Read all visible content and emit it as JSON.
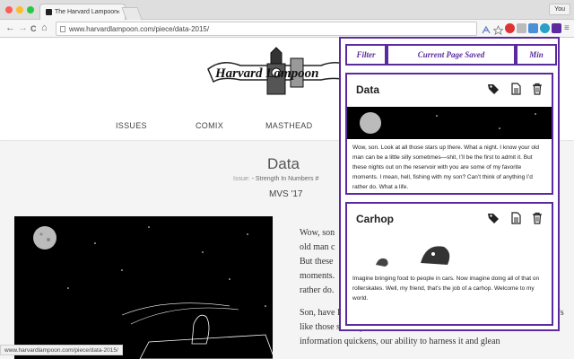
{
  "browser": {
    "tab_title": "The Harvard Lampoon",
    "tab_close": "×",
    "profile": "You",
    "url": "www.harvardlampoon.com/piece/data-2015/",
    "status_url": "www.harvardlampoon.com/piece/data-2015/",
    "nav": {
      "back": "←",
      "forward": "→",
      "reload": "C",
      "home": "⌂"
    },
    "menu": "≡"
  },
  "site": {
    "logo_text": "Harvard Lampoon",
    "menu": [
      "ISSUES",
      "COMIX",
      "MASTHEAD"
    ]
  },
  "article": {
    "title": "Data",
    "issue_label": "Issue:",
    "issue_value": " - Strength In Numbers #",
    "author": "MVS '17",
    "frag1": "Wow, son",
    "frag2": "old man c",
    "frag3": "But these",
    "frag4": "moments.",
    "frag5": "rather do.",
    "paragraph": "Son, have I ever talked to you about data? Maybe I have, yeah. But data’s like those stars up there, son. It’s all around us. And as the current of information quickens, our ability to harness it and glean"
  },
  "popup": {
    "filter": "Filter",
    "current": "Current Page Saved",
    "min": "Min",
    "cards": [
      {
        "title": "Data",
        "text": "Wow, son. Look at all those stars up there. What a night. I know your old man can be a little silly sometimes—shit, I’ll be the first to admit it. But these nights out on the reservoir with you are some of my favorite moments. I mean, hell, fishing with my son? Can’t think of anything I’d rather do. What a life."
      },
      {
        "title": "Carhop",
        "text": "Imagine bringing food to people in cars. Now imagine doing all of that on rollerskates. Well, my friend, that’s the job of a carhop. Welcome to my world."
      }
    ]
  },
  "colors": {
    "accent": "#5b2a9e"
  }
}
